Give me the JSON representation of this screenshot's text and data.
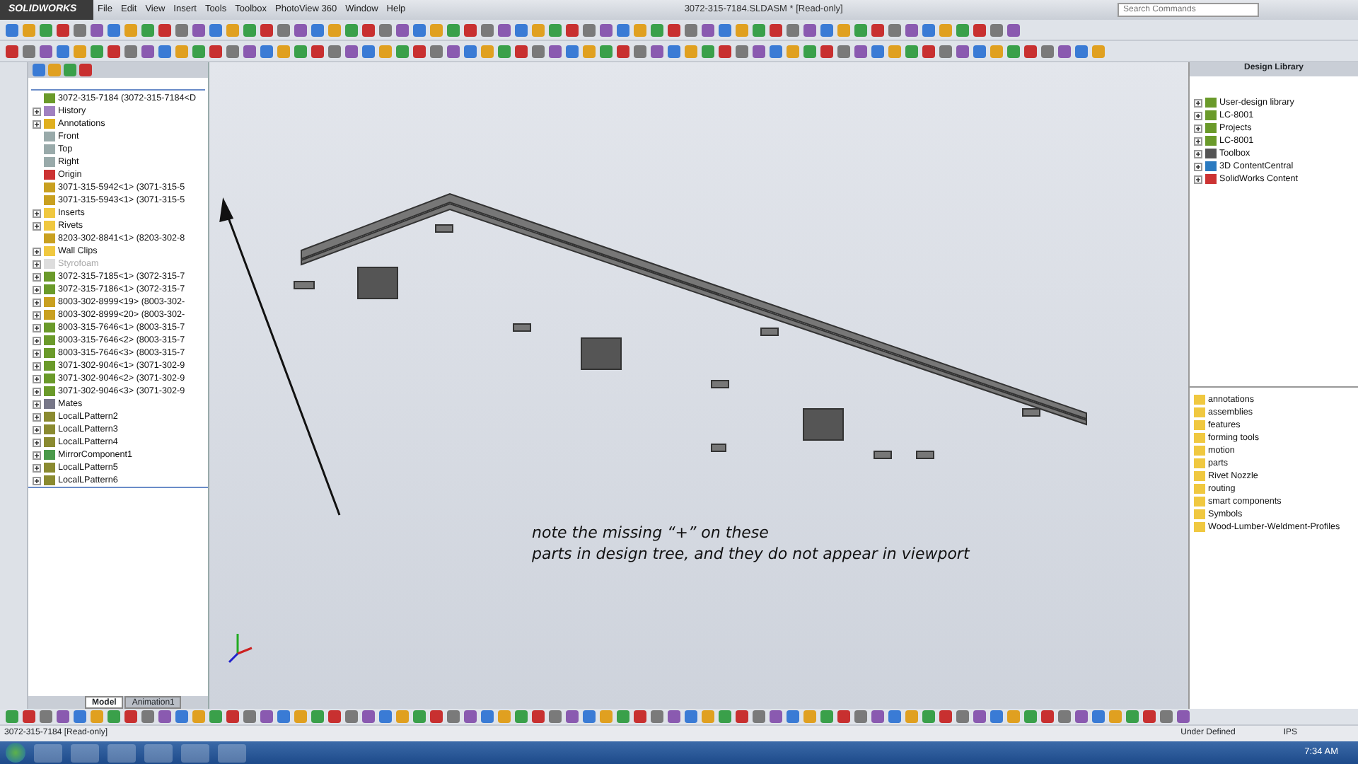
{
  "app": {
    "logo": "SOLIDWORKS",
    "menu": [
      "File",
      "Edit",
      "View",
      "Insert",
      "Tools",
      "Toolbox",
      "PhotoView 360",
      "Window",
      "Help"
    ],
    "title": "3072-315-7184.SLDASM * [Read-only]",
    "search": {
      "placeholder": "Search Commands"
    }
  },
  "tree": {
    "root": "3072-315-7184  (3072-315-7184<D",
    "items": [
      {
        "kind": "history",
        "label": "History",
        "expandable": true,
        "suppressed": false
      },
      {
        "kind": "annotations",
        "label": "Annotations",
        "expandable": true,
        "suppressed": false
      },
      {
        "kind": "plane",
        "label": "Front",
        "expandable": false,
        "suppressed": false
      },
      {
        "kind": "plane",
        "label": "Top",
        "expandable": false,
        "suppressed": false
      },
      {
        "kind": "plane",
        "label": "Right",
        "expandable": false,
        "suppressed": false
      },
      {
        "kind": "origin",
        "label": "Origin",
        "expandable": false,
        "suppressed": false
      },
      {
        "kind": "part",
        "label": "3071-315-5942<1> (3071-315-5",
        "expandable": false,
        "suppressed": false
      },
      {
        "kind": "part",
        "label": "3071-315-5943<1> (3071-315-5",
        "expandable": false,
        "suppressed": false
      },
      {
        "kind": "folder",
        "label": "Inserts",
        "expandable": true,
        "suppressed": false
      },
      {
        "kind": "folder",
        "label": "Rivets",
        "expandable": true,
        "suppressed": false
      },
      {
        "kind": "part",
        "label": "8203-302-8841<1> (8203-302-8",
        "expandable": false,
        "suppressed": false
      },
      {
        "kind": "folder",
        "label": "Wall Clips",
        "expandable": true,
        "suppressed": false
      },
      {
        "kind": "folder",
        "label": "Styrofoam",
        "expandable": true,
        "suppressed": true
      },
      {
        "kind": "assembly",
        "label": "3072-315-7185<1> (3072-315-7",
        "expandable": true,
        "suppressed": false
      },
      {
        "kind": "assembly",
        "label": "3072-315-7186<1> (3072-315-7",
        "expandable": true,
        "suppressed": false
      },
      {
        "kind": "part",
        "label": "8003-302-8999<19> (8003-302-",
        "expandable": true,
        "suppressed": false
      },
      {
        "kind": "part",
        "label": "8003-302-8999<20> (8003-302-",
        "expandable": true,
        "suppressed": false
      },
      {
        "kind": "assembly",
        "label": "8003-315-7646<1> (8003-315-7",
        "expandable": true,
        "suppressed": false
      },
      {
        "kind": "assembly",
        "label": "8003-315-7646<2> (8003-315-7",
        "expandable": true,
        "suppressed": false
      },
      {
        "kind": "assembly",
        "label": "8003-315-7646<3> (8003-315-7",
        "expandable": true,
        "suppressed": false
      },
      {
        "kind": "assembly",
        "label": "3071-302-9046<1> (3071-302-9",
        "expandable": true,
        "suppressed": false
      },
      {
        "kind": "assembly",
        "label": "3071-302-9046<2> (3071-302-9",
        "expandable": true,
        "suppressed": false
      },
      {
        "kind": "assembly",
        "label": "3071-302-9046<3> (3071-302-9",
        "expandable": true,
        "suppressed": false
      },
      {
        "kind": "mates",
        "label": "Mates",
        "expandable": true,
        "suppressed": false
      },
      {
        "kind": "pattern",
        "label": "LocalLPattern2",
        "expandable": true,
        "suppressed": false
      },
      {
        "kind": "pattern",
        "label": "LocalLPattern3",
        "expandable": true,
        "suppressed": false
      },
      {
        "kind": "pattern",
        "label": "LocalLPattern4",
        "expandable": true,
        "suppressed": false
      },
      {
        "kind": "mirror",
        "label": "MirrorComponent1",
        "expandable": true,
        "suppressed": false
      },
      {
        "kind": "pattern",
        "label": "LocalLPattern5",
        "expandable": true,
        "suppressed": false
      },
      {
        "kind": "pattern",
        "label": "LocalLPattern6",
        "expandable": true,
        "suppressed": false
      }
    ]
  },
  "viewport": {
    "note": [
      "note the missing “+” on these",
      "parts in design tree, and they do not appear in viewport"
    ]
  },
  "bottom_tabs": [
    {
      "label": "Model",
      "selected": true
    },
    {
      "label": "Animation1",
      "selected": false
    }
  ],
  "design_library": {
    "title": "Design Library",
    "items": [
      {
        "kind": "library",
        "label": "User-design library"
      },
      {
        "kind": "library",
        "label": "LC-8001"
      },
      {
        "kind": "library",
        "label": "Projects"
      },
      {
        "kind": "library",
        "label": "LC-8001"
      },
      {
        "kind": "toolbox",
        "label": "Toolbox"
      },
      {
        "kind": "globe",
        "label": "3D ContentCentral"
      },
      {
        "kind": "content",
        "label": "SolidWorks Content"
      }
    ],
    "folders": [
      "annotations",
      "assemblies",
      "features",
      "forming tools",
      "motion",
      "parts",
      "Rivet Nozzle",
      "routing",
      "smart components",
      "Symbols",
      "Wood-Lumber-Weldment-Profiles"
    ]
  },
  "status_bar": {
    "document": "3072-315-7184 [Read-only]",
    "state": "Under Defined",
    "units": "IPS"
  },
  "taskbar": {
    "time": "7:34 AM"
  }
}
